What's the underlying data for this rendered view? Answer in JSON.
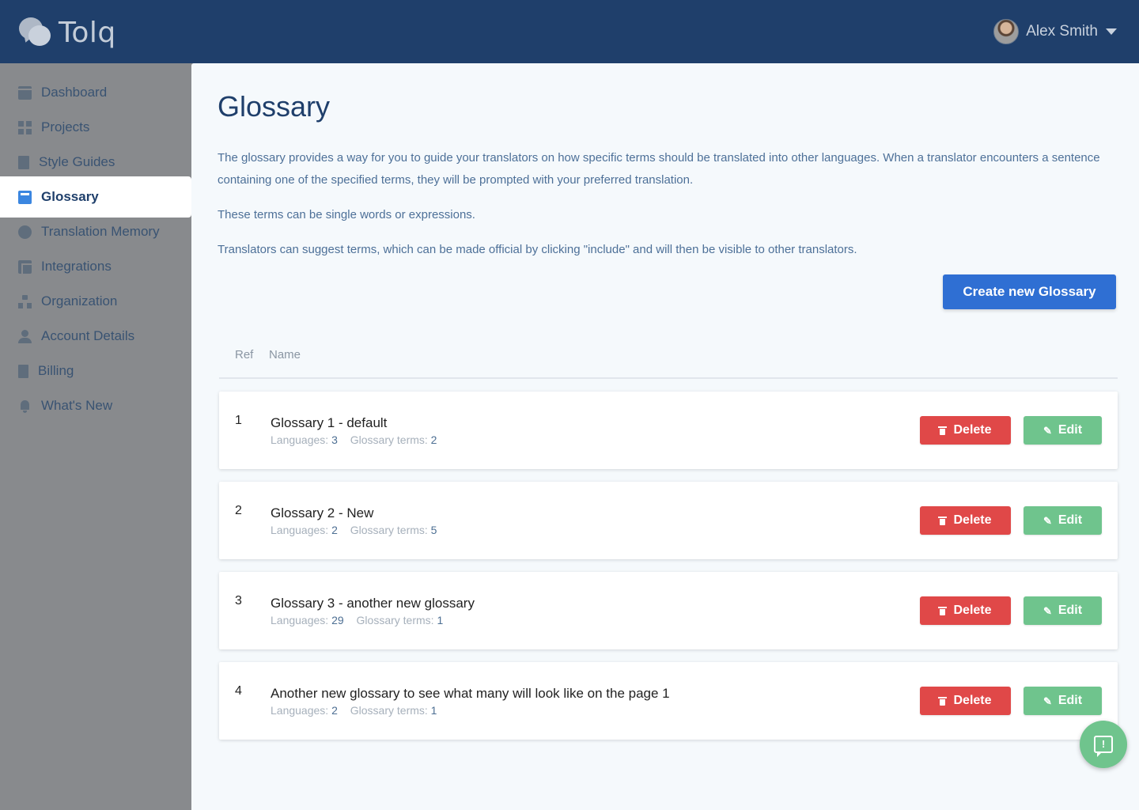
{
  "brand": {
    "name": "Tolq"
  },
  "user": {
    "name": "Alex Smith"
  },
  "sidebar": {
    "items": [
      {
        "label": "Dashboard",
        "icon": "dashboard-icon"
      },
      {
        "label": "Projects",
        "icon": "grid-icon"
      },
      {
        "label": "Style Guides",
        "icon": "document-icon"
      },
      {
        "label": "Glossary",
        "icon": "book-icon",
        "active": true
      },
      {
        "label": "Translation Memory",
        "icon": "chat-bubble-icon"
      },
      {
        "label": "Integrations",
        "icon": "integrations-icon"
      },
      {
        "label": "Organization",
        "icon": "organization-icon"
      },
      {
        "label": "Account Details",
        "icon": "user-icon"
      },
      {
        "label": "Billing",
        "icon": "receipt-icon"
      },
      {
        "label": "What's New",
        "icon": "bell-icon"
      }
    ]
  },
  "page": {
    "title": "Glossary",
    "description": [
      "The glossary provides a way for you to guide your translators on how specific terms should be translated into other languages. When a translator encounters a sentence containing one of the specified terms, they will be prompted with your preferred translation.",
      "These terms can be single words or expressions.",
      "Translators can suggest terms, which can be made official by clicking \"include\" and will then be visible to other translators."
    ],
    "create_button": "Create new Glossary"
  },
  "table": {
    "headers": {
      "ref": "Ref",
      "name": "Name"
    },
    "meta_labels": {
      "languages": "Languages:",
      "terms": "Glossary terms:"
    },
    "delete_label": "Delete",
    "edit_label": "Edit",
    "rows": [
      {
        "ref": "1",
        "name": "Glossary 1 - default",
        "languages": "3",
        "terms": "2"
      },
      {
        "ref": "2",
        "name": "Glossary 2 - New",
        "languages": "2",
        "terms": "5"
      },
      {
        "ref": "3",
        "name": "Glossary 3 - another new glossary",
        "languages": "29",
        "terms": "1"
      },
      {
        "ref": "4",
        "name": "Another new glossary to see what many will look like on the page 1",
        "languages": "2",
        "terms": "1"
      }
    ]
  },
  "colors": {
    "header_bg": "#1f3f6b",
    "primary": "#2f6fd3",
    "danger": "#e04848",
    "success": "#6fc48d"
  },
  "feedback": {
    "icon": "feedback-icon"
  }
}
